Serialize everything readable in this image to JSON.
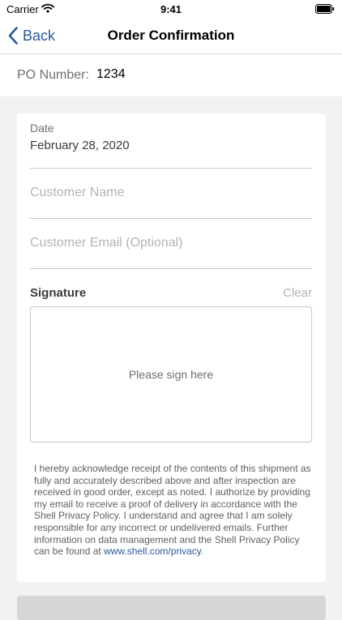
{
  "status_bar": {
    "carrier": "Carrier",
    "time": "9:41"
  },
  "nav": {
    "back_label": "Back",
    "title": "Order Confirmation"
  },
  "po": {
    "label": "PO Number:",
    "value": "1234"
  },
  "form": {
    "date_label": "Date",
    "date_value": "February 28, 2020",
    "customer_name_placeholder": "Customer Name",
    "customer_email_placeholder": "Customer Email (Optional)",
    "signature_label": "Signature",
    "clear_label": "Clear",
    "signature_hint": "Please sign here"
  },
  "legal": {
    "text": "I hereby acknowledge receipt of the contents of this shipment as fully and accurately described above and after inspection are received in good order, except as noted. I authorize by providing my email to receive a proof of delivery in accordance with the Shell Privacy Policy. I understand and agree that I am solely responsible for any incorrect or undelivered emails. Further information on data management and the Shell Privacy Policy can be found at ",
    "link_text": "www.shell.com/privacy",
    "trailing": "."
  },
  "colors": {
    "accent": "#2a5a9b",
    "background": "#f2f2f4",
    "placeholder": "#b4b4b9"
  },
  "icons": [
    "wifi-icon",
    "battery-icon",
    "back-chevron-icon"
  ]
}
